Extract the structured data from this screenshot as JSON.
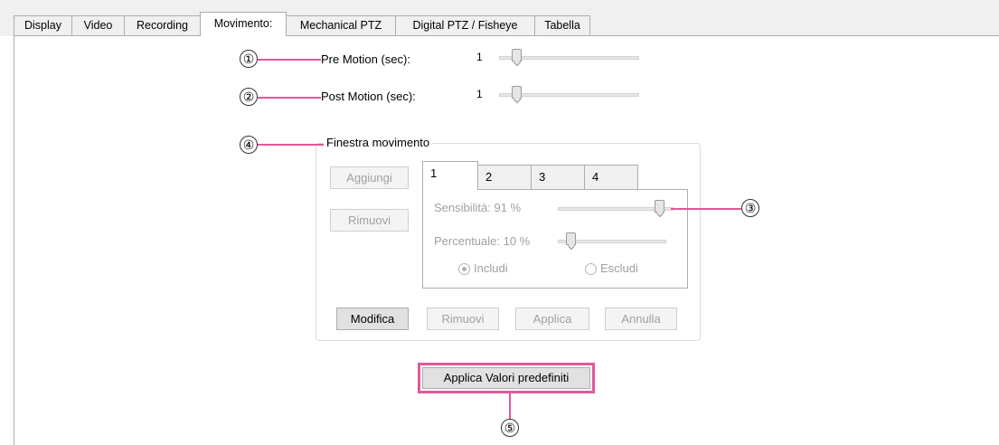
{
  "tabs": [
    {
      "label": "Display"
    },
    {
      "label": "Video"
    },
    {
      "label": "Recording"
    },
    {
      "label": "Movimento:"
    },
    {
      "label": "Mechanical PTZ"
    },
    {
      "label": "Digital PTZ / Fisheye"
    },
    {
      "label": "Tabella"
    }
  ],
  "active_tab": "Movimento:",
  "pre_motion": {
    "label": "Pre Motion (sec):",
    "value": "1"
  },
  "post_motion": {
    "label": "Post Motion (sec):",
    "value": "1"
  },
  "motion_window": {
    "title": "Finestra movimento",
    "add_button": "Aggiungi",
    "remove_button": "Rimuovi",
    "window_tabs": [
      "1",
      "2",
      "3",
      "4"
    ],
    "active_window_tab": "1",
    "sensitivity_label": "Sensibilità: 91 %",
    "sensitivity_value": 91,
    "percent_label": "Percentuale: 10 %",
    "percent_value": 10,
    "include_label": "Includi",
    "exclude_label": "Escludi",
    "include_selected": true,
    "edit_button": "Modifica",
    "remove2_button": "Rimuovi",
    "apply_button": "Applica",
    "cancel_button": "Annulla"
  },
  "defaults_button": "Applica Valori predefiniti",
  "callouts": [
    "①",
    "②",
    "③",
    "④",
    "⑤"
  ],
  "colors": {
    "callout_line": "#e2589a",
    "panel_bg": "#f0f0f0"
  }
}
